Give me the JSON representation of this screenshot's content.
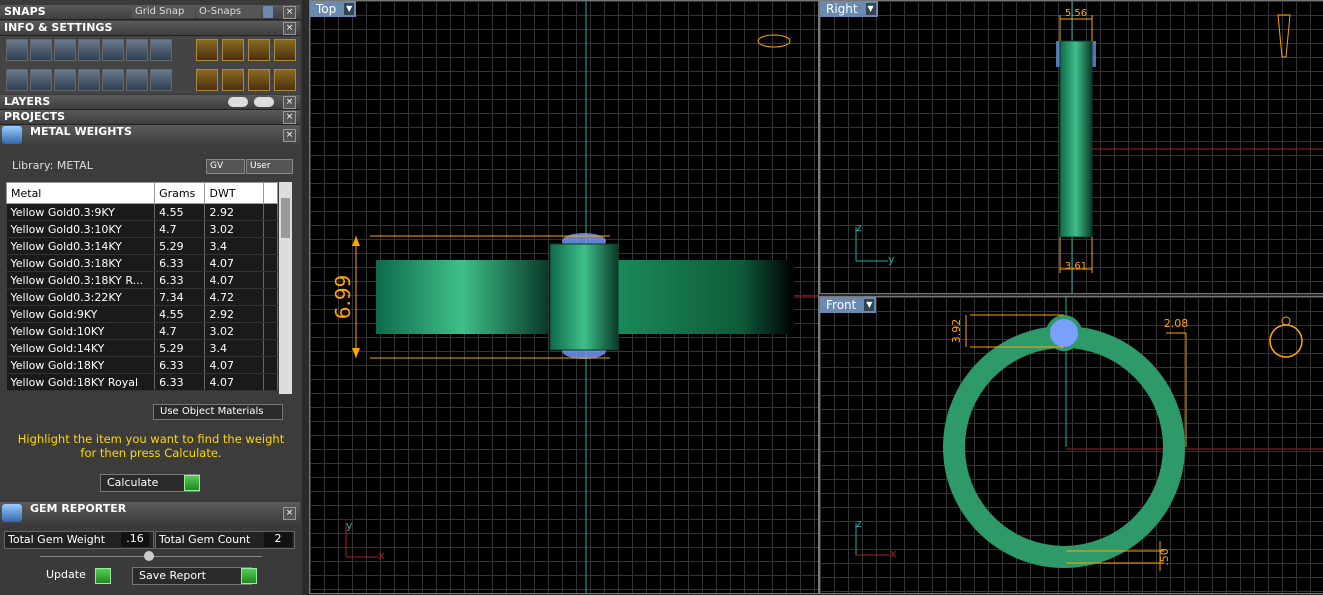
{
  "snaps": {
    "title": "SNAPS",
    "grid_snap": "Grid Snap",
    "o_snaps": "O-Snaps"
  },
  "info": {
    "title": "INFO & SETTINGS"
  },
  "layers": {
    "title": "LAYERS"
  },
  "projects": {
    "title": "PROJECTS"
  },
  "metal_weights": {
    "title": "METAL WEIGHTS",
    "library": "Library: METAL",
    "gv": "GV",
    "user": "User",
    "columns": [
      "Metal",
      "Grams",
      "DWT"
    ],
    "rows": [
      [
        "Yellow Gold0.3:9KY",
        "4.55",
        "2.92"
      ],
      [
        "Yellow Gold0.3:10KY",
        "4.7",
        "3.02"
      ],
      [
        "Yellow Gold0.3:14KY",
        "5.29",
        "3.4"
      ],
      [
        "Yellow Gold0.3:18KY",
        "6.33",
        "4.07"
      ],
      [
        "Yellow Gold0.3:18KY R...",
        "6.33",
        "4.07"
      ],
      [
        "Yellow Gold0.3:22KY",
        "7.34",
        "4.72"
      ],
      [
        "Yellow Gold:9KY",
        "4.55",
        "2.92"
      ],
      [
        "Yellow Gold:10KY",
        "4.7",
        "3.02"
      ],
      [
        "Yellow Gold:14KY",
        "5.29",
        "3.4"
      ],
      [
        "Yellow Gold:18KY",
        "6.33",
        "4.07"
      ],
      [
        "Yellow Gold:18KY Royal",
        "6.33",
        "4.07"
      ]
    ],
    "use_object_materials": "Use Object Materials",
    "hint": "Highlight the item you want to find the weight for then press Calculate.",
    "calculate": "Calculate"
  },
  "gem_reporter": {
    "title": "GEM REPORTER",
    "total_gem_weight_label": "Total Gem Weight",
    "total_gem_weight": ".16",
    "total_gem_count_label": "Total Gem Count",
    "total_gem_count": "2",
    "update": "Update",
    "save_report": "Save Report"
  },
  "viewports": {
    "top": {
      "label": "Top",
      "dim": "6.99"
    },
    "right": {
      "label": "Right",
      "dim_top": "5.56",
      "dim_bottom": "3.61"
    },
    "front": {
      "label": "Front",
      "dim_left": "3.92",
      "dim_right": "2.08",
      "dim_bottom": ".50"
    }
  },
  "axes": {
    "x": "x",
    "y": "y",
    "z": "z"
  },
  "colors": {
    "accent": "#6a8ab0",
    "ring": "#2e9a6a",
    "dim": "#ffa500",
    "gem": "#7aa0ff"
  }
}
